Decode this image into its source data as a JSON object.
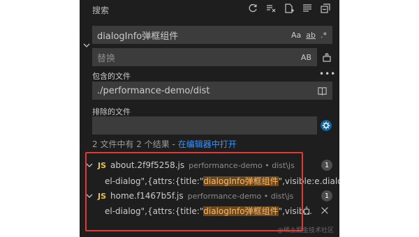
{
  "panel": {
    "title": "搜索",
    "toolbar_icons": [
      "refresh-icon",
      "clear-results-icon",
      "new-search-editor-icon",
      "view-as-tree-icon",
      "collapse-all-icon"
    ]
  },
  "search": {
    "value": "dialogInfo弹框组件",
    "options": [
      "Aa",
      "ab",
      ".*"
    ]
  },
  "replace": {
    "placeholder": "替换",
    "option": "AB"
  },
  "include": {
    "label": "包含的文件",
    "value": "./performance-demo/dist"
  },
  "exclude": {
    "label": "排除的文件",
    "value": ""
  },
  "summary": {
    "text": "2 文件中有 2 个结果 - ",
    "link": "在编辑器中打开"
  },
  "results": [
    {
      "lang": "JS",
      "file": "about.2f9f5258.js",
      "path": "performance-demo • dist\\js",
      "count": "1",
      "match_before": "el-dialog\",{attrs:{title:\"",
      "match": "dialogInfo弹框组件",
      "match_after": "\",visible:e.dialog..."
    },
    {
      "lang": "JS",
      "file": "home.f1467b5f.js",
      "path": "performance-demo • dist\\js",
      "count": "1",
      "match_before": "el-dialog\",{attrs:{title:\"",
      "match": "dialogInfo弹框组件",
      "match_after": "\",visib..."
    }
  ],
  "watermark": "@稀土掘金技术社区"
}
